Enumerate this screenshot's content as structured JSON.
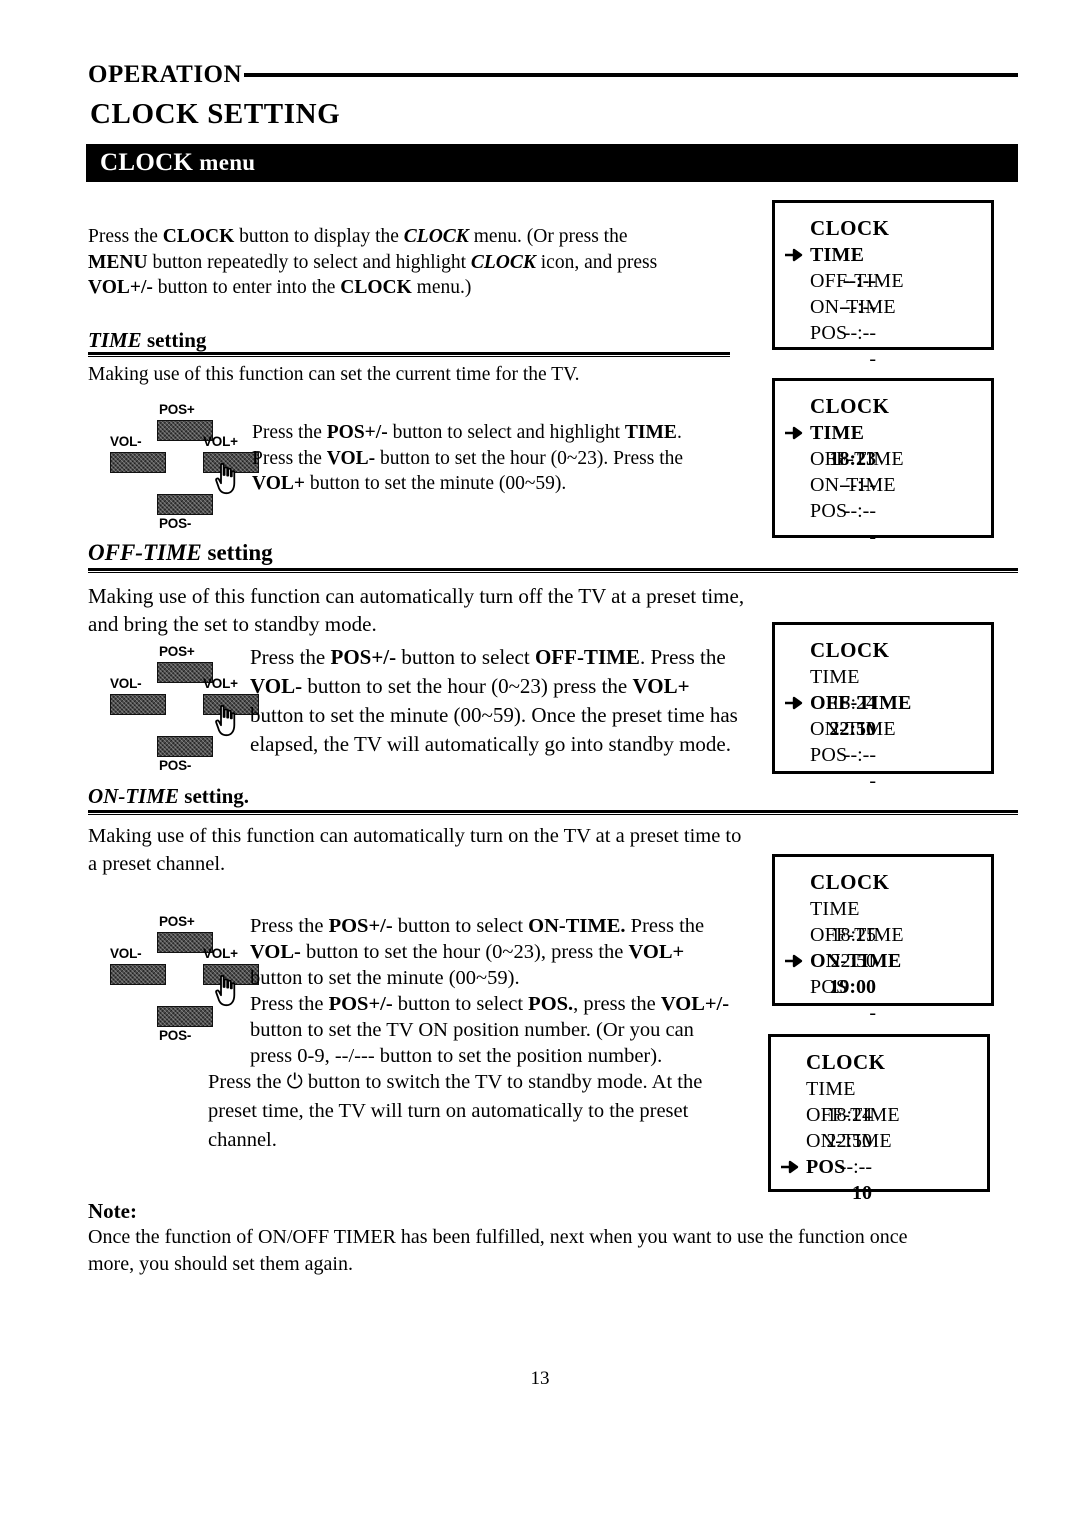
{
  "header": {
    "operation_label": "OPERATION",
    "page_title": "CLOCK SETTING",
    "menu_bar_main": "CLOCK",
    "menu_bar_sub": " menu"
  },
  "intro": {
    "line1_a": "Press the ",
    "line1_b": "CLOCK",
    "line1_c": " button to display the ",
    "line1_d": "CLOCK",
    "line1_e": " menu. (Or press the",
    "line2_a": "MENU",
    "line2_b": " button repeatedly to select and highlight ",
    "line2_c": "CLOCK",
    "line2_d": " icon, and press",
    "line3_a": "VOL+/-",
    "line3_b": " button to enter into the ",
    "line3_c": "CLOCK",
    "line3_d": " menu.)"
  },
  "sections": [
    {
      "heading_italic": "TIME",
      "heading_normal": " setting",
      "description": "Making use of this function can set the current time for the TV.",
      "steps": {
        "l1_a": "Press the ",
        "l1_b": "POS+/-",
        "l1_c": " button to select and highlight ",
        "l1_d": "TIME",
        "l1_e": ".",
        "l2_a": "Press the ",
        "l2_b": "VOL-",
        "l2_c": " button to set the hour (0~23). Press the",
        "l3_a": "VOL+",
        "l3_b": " button to set the minute (00~59)."
      }
    },
    {
      "heading_italic": "OFF-TIME",
      "heading_normal": " setting",
      "description_l1": "Making use of this function can automatically turn off the TV at a preset time,",
      "description_l2": "and bring the set to standby mode.",
      "steps": {
        "l1_a": "Press the ",
        "l1_b": "POS+/-",
        "l1_c": " button to select ",
        "l1_d": "OFF-TIME",
        "l1_e": ". Press the",
        "l2_a": "VOL-",
        "l2_b": " button to set the hour (0~23) press the ",
        "l2_c": "VOL+",
        "l3": "button to set the minute (00~59). Once the preset time has",
        "l4": "elapsed, the TV will automatically go into standby mode."
      }
    },
    {
      "heading_italic": "ON-TIME",
      "heading_normal": " setting.",
      "description_l1": "Making use of this function can automatically turn on the TV at a preset time to",
      "description_l2": "a preset channel.",
      "steps": {
        "l1_a": "Press the ",
        "l1_b": "POS+/-",
        "l1_c": " button to select ",
        "l1_d": "ON-TIME.",
        "l1_e": " Press the",
        "l2_a": "VOL-",
        "l2_b": " button to set the hour (0~23), press the ",
        "l2_c": "VOL+",
        "l3": "button to set the minute (00~59).",
        "l4_a": "Press the ",
        "l4_b": "POS+/-",
        "l4_c": " button to select ",
        "l4_d": "POS.",
        "l4_e": ", press the ",
        "l4_f": "VOL+/-",
        "l5": "button to set the TV ON position number. (Or you can",
        "l6": "press 0-9, --/--- button to set the position number)."
      },
      "standby": {
        "l1_a": "Press the ",
        "l1_icon": "⏻",
        "l1_b": " button to switch the TV to standby mode. At the",
        "l2": "preset time, the TV will turn on automatically to the preset",
        "l3": "channel."
      }
    }
  ],
  "keypads": {
    "pos_plus": "POS+",
    "pos_minus": "POS-",
    "vol_minus": "VOL-",
    "vol_plus": "VOL+"
  },
  "osd_panels": [
    {
      "title": "CLOCK",
      "selected": "TIME",
      "rows": [
        {
          "label": "TIME",
          "value": "--:--"
        },
        {
          "label": "OFF-TIME",
          "value": "--:--"
        },
        {
          "label": "ON-TIME",
          "value": "--:--"
        },
        {
          "label": "POS",
          "value": "-"
        }
      ]
    },
    {
      "title": "CLOCK",
      "selected": "TIME",
      "rows": [
        {
          "label": "TIME",
          "value": "18:23"
        },
        {
          "label": "OFF-TIME",
          "value": "--:--"
        },
        {
          "label": "ON-TIME",
          "value": "--:--"
        },
        {
          "label": "POS",
          "value": "-"
        }
      ]
    },
    {
      "title": "CLOCK",
      "selected": "OFF-TIME",
      "rows": [
        {
          "label": "TIME",
          "value": "18:24"
        },
        {
          "label": "OFF-TIME",
          "value": "22:50"
        },
        {
          "label": "ON-TIME",
          "value": "--:--"
        },
        {
          "label": "POS",
          "value": "-"
        }
      ]
    },
    {
      "title": "CLOCK",
      "selected": "ON-TIME",
      "rows": [
        {
          "label": "TIME",
          "value": "18:25"
        },
        {
          "label": "OFF-TIME",
          "value": "22:50"
        },
        {
          "label": "ON-TIME",
          "value": "19:00"
        },
        {
          "label": "POS",
          "value": "-"
        }
      ]
    },
    {
      "title": "CLOCK",
      "selected": "POS",
      "rows": [
        {
          "label": "TIME",
          "value": "18:24"
        },
        {
          "label": "OFF-TIME",
          "value": "22:50"
        },
        {
          "label": "ON-TIME",
          "value": "--:--"
        },
        {
          "label": "POS",
          "value": "10"
        }
      ]
    }
  ],
  "note": {
    "title": "Note:",
    "line1": "Once the function of ON/OFF TIMER has been fulfilled, next when you want to use the function once",
    "line2": "more, you should set them again."
  },
  "page_number": "13"
}
